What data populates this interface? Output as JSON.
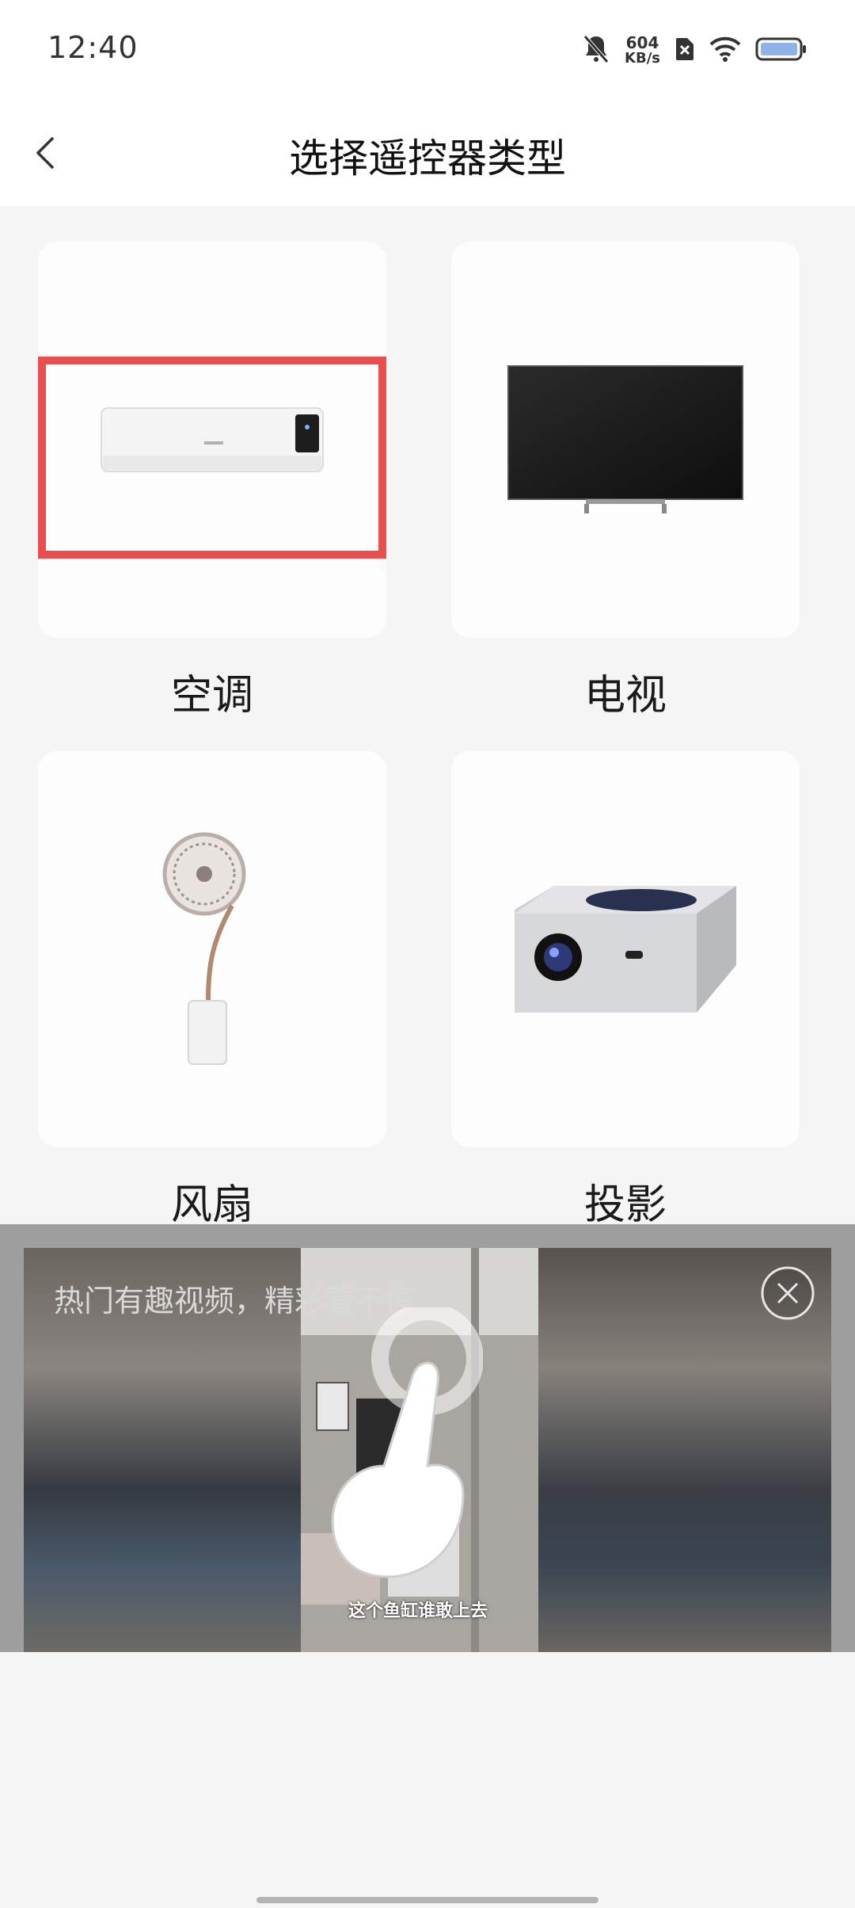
{
  "status_bar": {
    "time": "12:40",
    "net_speed_value": "604",
    "net_speed_unit": "KB/s"
  },
  "header": {
    "title": "选择遥控器类型"
  },
  "devices": [
    {
      "label": "空调",
      "icon": "air-conditioner-icon"
    },
    {
      "label": "电视",
      "icon": "tv-icon"
    },
    {
      "label": "风扇",
      "icon": "fan-icon"
    },
    {
      "label": "投影",
      "icon": "projector-icon"
    }
  ],
  "ad": {
    "headline": "热门有趣视频，精彩看不停",
    "caption": "这个鱼缸谁敢上去",
    "close_icon": "close-icon"
  },
  "colors": {
    "highlight": "#ea4f4f",
    "background": "#f5f5f5"
  }
}
